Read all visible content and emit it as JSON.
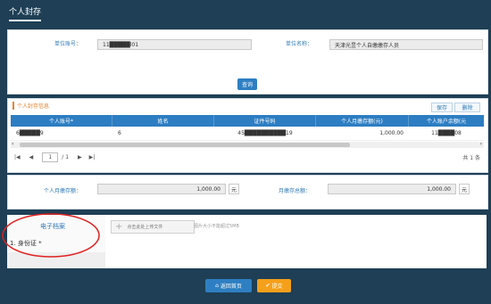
{
  "tab": {
    "title": "个人封存"
  },
  "form": {
    "unit_account_label": "单位账号：",
    "unit_account_value": "11█████l01",
    "unit_name_label": "单位名称：",
    "unit_name_value": "天津光昱个人自缴缴存人员",
    "query_button": "查询"
  },
  "table": {
    "title": "个人封存信息",
    "save_button": "保存",
    "delete_button": "删除",
    "headers": [
      "个人账号*",
      "姓名",
      "证件号码",
      "个人月缴存额(元)",
      "个人账户余额(元"
    ],
    "row": {
      "account": "6█████9",
      "name": "6",
      "id_no": "45██████████19",
      "monthly": "1,000.00",
      "balance": "11████08"
    },
    "pager": {
      "first": "|◀",
      "prev": "◀",
      "page": "1",
      "total_pages": "/ 1",
      "next": "▶",
      "last": "▶|",
      "total": "共 1 条"
    }
  },
  "summary": {
    "personal_label": "个人月缴存额：",
    "personal_value": "1,000.00",
    "personal_unit": "元",
    "monthly_label": "月缴存总额：",
    "monthly_value": "1,000.00",
    "monthly_unit": "元"
  },
  "archive": {
    "title": "电子档案",
    "upload_button": "点击此处上传文件",
    "size_hint": "图片大小不能超过5MB",
    "item_label": "1. 身份证 *"
  },
  "actions": {
    "back": "返回首页",
    "submit": "提交"
  },
  "colors": {
    "accent": "#2e7fc2",
    "orange": "#f5a01a",
    "annotation": "#e02020"
  }
}
